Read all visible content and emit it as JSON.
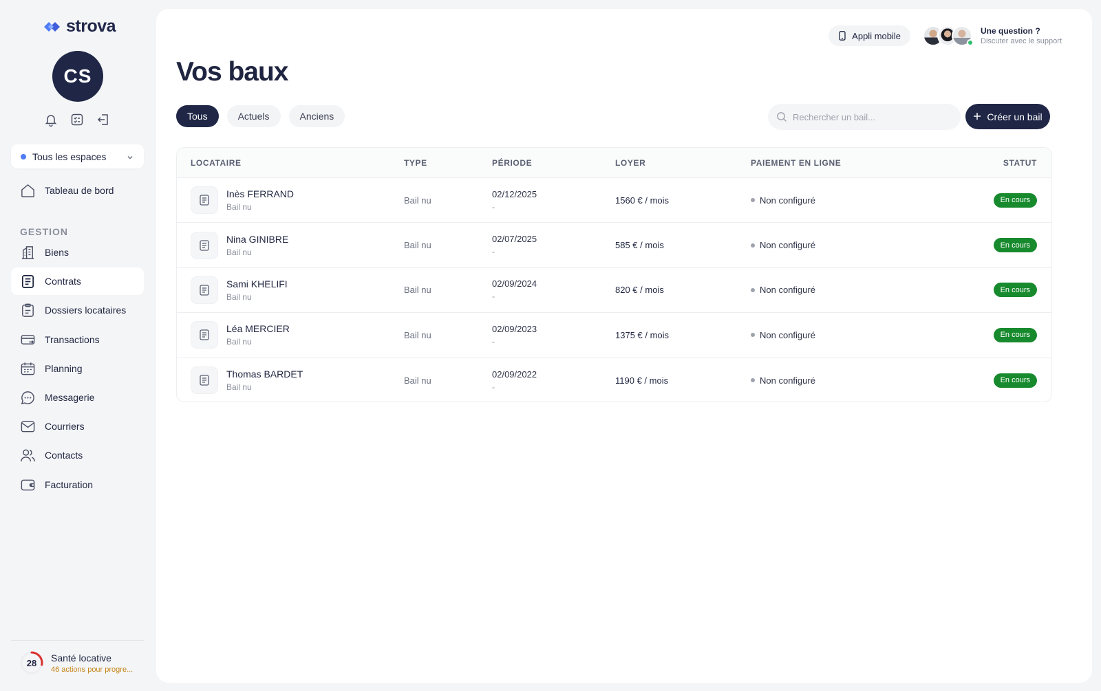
{
  "brand": {
    "name": "strova",
    "accent": "#4f7cf7",
    "dark": "#1f2646"
  },
  "user": {
    "initials": "CS"
  },
  "space_selector": {
    "label": "Tous les espaces"
  },
  "sidebar": {
    "dashboard": "Tableau de bord",
    "section": "GESTION",
    "items": [
      {
        "label": "Biens",
        "icon": "building-icon"
      },
      {
        "label": "Contrats",
        "icon": "document-icon"
      },
      {
        "label": "Dossiers locataires",
        "icon": "clipboard-icon"
      },
      {
        "label": "Transactions",
        "icon": "card-transfer-icon"
      },
      {
        "label": "Planning",
        "icon": "calendar-icon"
      },
      {
        "label": "Messagerie",
        "icon": "chat-icon"
      },
      {
        "label": "Courriers",
        "icon": "mail-icon"
      },
      {
        "label": "Contacts",
        "icon": "users-icon"
      },
      {
        "label": "Facturation",
        "icon": "wallet-icon"
      }
    ]
  },
  "health": {
    "score": "28",
    "title": "Santé locative",
    "subtitle": "46 actions pour progre...",
    "color": "#d9322e"
  },
  "header": {
    "app_button": "Appli mobile",
    "support_title": "Une question ?",
    "support_sub": "Discuter avec le support"
  },
  "page": {
    "title": "Vos baux"
  },
  "tabs": [
    {
      "label": "Tous",
      "active": true
    },
    {
      "label": "Actuels",
      "active": false
    },
    {
      "label": "Anciens",
      "active": false
    }
  ],
  "search": {
    "placeholder": "Rechercher un bail..."
  },
  "create_button": "Créer un bail",
  "table": {
    "headers": {
      "locataire": "LOCATAIRE",
      "type": "TYPE",
      "periode": "PÉRIODE",
      "loyer": "LOYER",
      "paiement": "PAIEMENT EN LIGNE",
      "statut": "STATUT"
    },
    "rows": [
      {
        "name": "Inès FERRAND",
        "sub": "Bail nu",
        "type": "Bail nu",
        "start": "02/12/2025",
        "end": "-",
        "rent": "1560 € / mois",
        "payment": "Non configuré",
        "status": "En cours"
      },
      {
        "name": "Nina GINIBRE",
        "sub": "Bail nu",
        "type": "Bail nu",
        "start": "02/07/2025",
        "end": "-",
        "rent": "585 € / mois",
        "payment": "Non configuré",
        "status": "En cours"
      },
      {
        "name": "Sami KHELIFI",
        "sub": "Bail nu",
        "type": "Bail nu",
        "start": "02/09/2024",
        "end": "-",
        "rent": "820 € / mois",
        "payment": "Non configuré",
        "status": "En cours"
      },
      {
        "name": "Léa MERCIER",
        "sub": "Bail nu",
        "type": "Bail nu",
        "start": "02/09/2023",
        "end": "-",
        "rent": "1375 € / mois",
        "payment": "Non configuré",
        "status": "En cours"
      },
      {
        "name": "Thomas BARDET",
        "sub": "Bail nu",
        "type": "Bail nu",
        "start": "02/09/2022",
        "end": "-",
        "rent": "1190 € / mois",
        "payment": "Non configuré",
        "status": "En cours"
      }
    ]
  }
}
